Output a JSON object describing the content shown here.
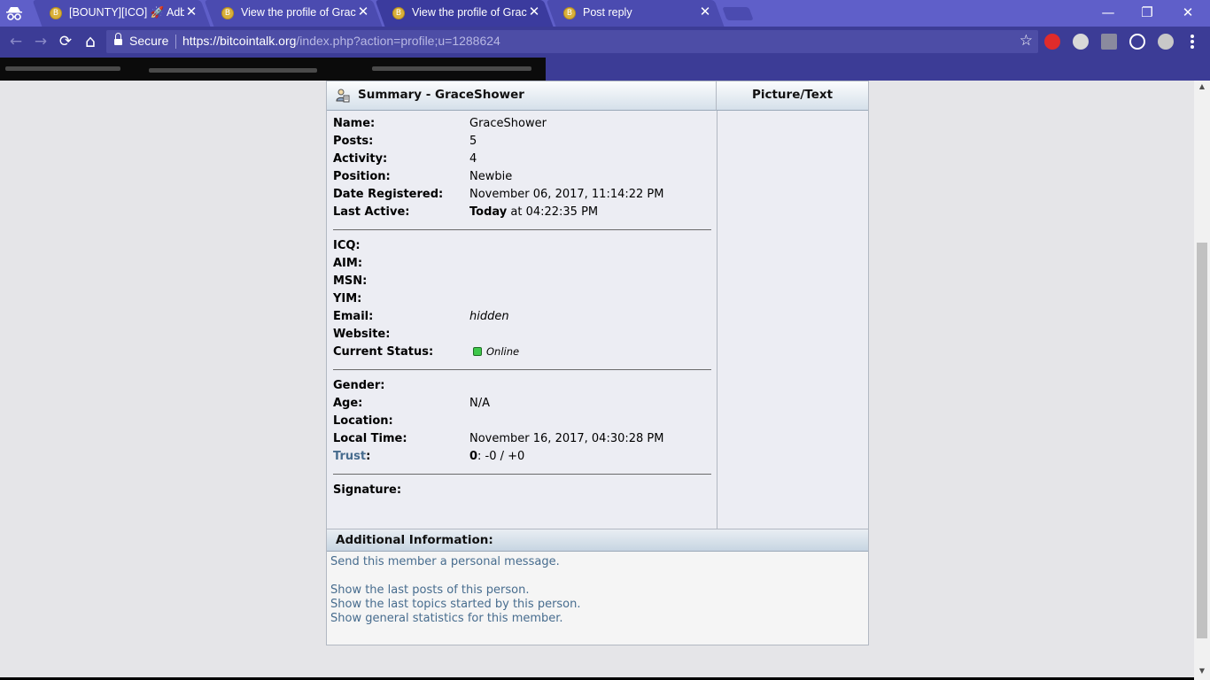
{
  "tabs": [
    {
      "title": "[BOUNTY][ICO] 🚀 Adbank",
      "favicon": "B",
      "active": false
    },
    {
      "title": "View the profile of GraceShower",
      "favicon": "B",
      "active": false
    },
    {
      "title": "View the profile of GraceShower",
      "favicon": "B",
      "active": true
    },
    {
      "title": "Post reply",
      "favicon": "B",
      "active": false
    }
  ],
  "tab_close_glyph": "✕",
  "window_controls": {
    "minimize": "—",
    "restore": "❐",
    "close": "✕"
  },
  "toolbar": {
    "back": "←",
    "forward": "→",
    "reload": "⟳",
    "home": "⌂",
    "star": "☆"
  },
  "address_bar": {
    "security_label": "Secure",
    "url_host": "https://bitcointalk.org",
    "url_path": "/index.php?action=profile;u=1288624"
  },
  "profile": {
    "summary_title": "Summary - GraceShower",
    "picture_header": "Picture/Text",
    "name_label": "Name:",
    "name_value": "GraceShower",
    "posts_label": "Posts:",
    "posts_value": "5",
    "activity_label": "Activity:",
    "activity_value": "4",
    "position_label": "Position:",
    "position_value": "Newbie",
    "registered_label": "Date Registered:",
    "registered_value": "November 06, 2017, 11:14:22 PM",
    "last_active_label": "Last Active:",
    "last_active_today": "Today",
    "last_active_rest": " at 04:22:35 PM",
    "icq_label": "ICQ:",
    "aim_label": "AIM:",
    "msn_label": "MSN:",
    "yim_label": "YIM:",
    "email_label": "Email:",
    "email_value": "hidden",
    "website_label": "Website:",
    "status_label": "Current Status:",
    "status_value": "Online",
    "gender_label": "Gender:",
    "age_label": "Age:",
    "age_value": "N/A",
    "location_label": "Location:",
    "local_time_label": "Local Time:",
    "local_time_value": "November 16, 2017, 04:30:28 PM",
    "trust_label": "Trust",
    "trust_colon": ":",
    "trust_score": "0",
    "trust_rest": ": -0 / +0",
    "signature_label": "Signature:"
  },
  "additional": {
    "header": "Additional Information:",
    "send_pm": "Send this member a personal message.",
    "last_posts": "Show the last posts of this person.",
    "last_topics": "Show the last topics started by this person.",
    "general_stats": "Show general statistics for this member."
  },
  "colors": {
    "tabstrip": "#5f5fc9",
    "toolbar": "#3c3c96",
    "link": "#476c8e",
    "online": "#3ec74a"
  }
}
